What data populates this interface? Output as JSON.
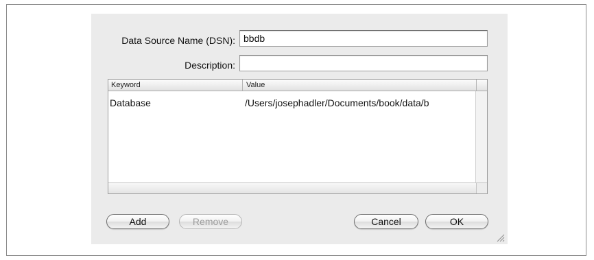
{
  "form": {
    "dsn_label": "Data Source Name (DSN):",
    "dsn_value": "bbdb",
    "description_label": "Description:",
    "description_value": ""
  },
  "table": {
    "columns": [
      "Keyword",
      "Value"
    ],
    "rows": [
      {
        "keyword": "Database",
        "value": "/Users/josephadler/Documents/book/data/b"
      }
    ]
  },
  "buttons": {
    "add": "Add",
    "remove": "Remove",
    "cancel": "Cancel",
    "ok": "OK"
  }
}
